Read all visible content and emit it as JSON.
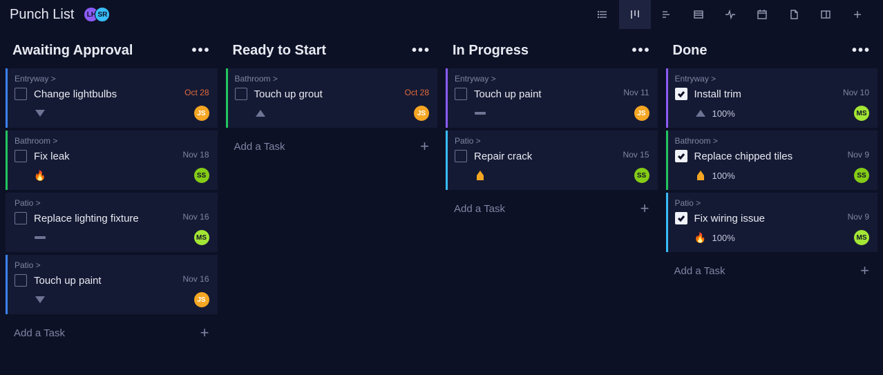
{
  "header": {
    "title": "Punch List",
    "avatars": [
      {
        "initials": "LH",
        "color": "#8b5cf6"
      },
      {
        "initials": "SR",
        "color": "#38bdf8"
      }
    ]
  },
  "toolbar": {
    "items": [
      {
        "name": "list-view-icon"
      },
      {
        "name": "kanban-view-icon",
        "active": true
      },
      {
        "name": "gantt-view-icon"
      },
      {
        "name": "table-view-icon"
      },
      {
        "name": "activity-view-icon"
      },
      {
        "name": "calendar-view-icon"
      },
      {
        "name": "file-view-icon"
      },
      {
        "name": "panel-view-icon"
      },
      {
        "name": "add-view-icon"
      }
    ]
  },
  "add_task_label": "Add a Task",
  "columns": [
    {
      "title": "Awaiting Approval",
      "cards": [
        {
          "crumb": "Entryway >",
          "title": "Change lightbulbs",
          "date": "Oct 28",
          "overdue": true,
          "priority": "low",
          "accent": "bl-blue",
          "assignee": {
            "initials": "JS",
            "color": "bg-orange"
          },
          "checked": false
        },
        {
          "crumb": "Bathroom >",
          "title": "Fix leak",
          "date": "Nov 18",
          "overdue": false,
          "priority": "urgent",
          "accent": "bl-green",
          "assignee": {
            "initials": "SS",
            "color": "bg-green"
          },
          "checked": false
        },
        {
          "crumb": "Patio >",
          "title": "Replace lighting fixture",
          "date": "Nov 16",
          "overdue": false,
          "priority": "none",
          "accent": "",
          "assignee": {
            "initials": "MS",
            "color": "bg-lime"
          },
          "checked": false
        },
        {
          "crumb": "Patio >",
          "title": "Touch up paint",
          "date": "Nov 16",
          "overdue": false,
          "priority": "low",
          "accent": "bl-blue",
          "assignee": {
            "initials": "JS",
            "color": "bg-orange"
          },
          "checked": false
        }
      ]
    },
    {
      "title": "Ready to Start",
      "cards": [
        {
          "crumb": "Bathroom >",
          "title": "Touch up grout",
          "date": "Oct 28",
          "overdue": true,
          "priority": "lowprogress",
          "accent": "bl-green",
          "assignee": {
            "initials": "JS",
            "color": "bg-orange"
          },
          "checked": false
        }
      ]
    },
    {
      "title": "In Progress",
      "cards": [
        {
          "crumb": "Entryway >",
          "title": "Touch up paint",
          "date": "Nov 11",
          "overdue": false,
          "priority": "none",
          "accent": "bl-purple",
          "assignee": {
            "initials": "JS",
            "color": "bg-orange"
          },
          "checked": false
        },
        {
          "crumb": "Patio >",
          "title": "Repair crack",
          "date": "Nov 15",
          "overdue": false,
          "priority": "medium",
          "accent": "bl-lightblue",
          "assignee": {
            "initials": "SS",
            "color": "bg-green"
          },
          "checked": false
        }
      ]
    },
    {
      "title": "Done",
      "cards": [
        {
          "crumb": "Entryway >",
          "title": "Install trim",
          "date": "Nov 10",
          "overdue": false,
          "priority": "lowprogress",
          "progress": "100%",
          "accent": "bl-purple",
          "assignee": {
            "initials": "MS",
            "color": "bg-lime"
          },
          "checked": true
        },
        {
          "crumb": "Bathroom >",
          "title": "Replace chipped tiles",
          "date": "Nov 9",
          "overdue": false,
          "priority": "medium",
          "progress": "100%",
          "accent": "bl-green",
          "assignee": {
            "initials": "SS",
            "color": "bg-green"
          },
          "checked": true
        },
        {
          "crumb": "Patio >",
          "title": "Fix wiring issue",
          "date": "Nov 9",
          "overdue": false,
          "priority": "urgent",
          "progress": "100%",
          "accent": "bl-lightblue",
          "assignee": {
            "initials": "MS",
            "color": "bg-lime"
          },
          "checked": true
        }
      ]
    }
  ]
}
